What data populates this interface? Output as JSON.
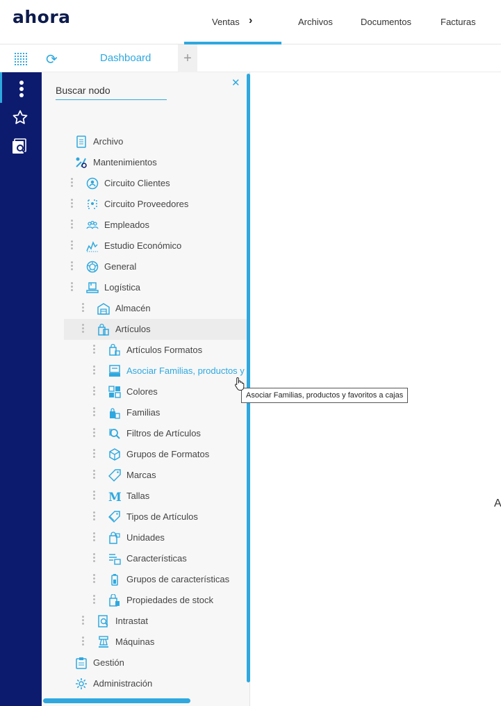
{
  "app": {
    "logo_text": "ahora"
  },
  "topnav": {
    "items": [
      {
        "label": "Ventas",
        "active": true
      },
      {
        "label": "Archivos"
      },
      {
        "label": "Documentos"
      },
      {
        "label": "Facturas"
      }
    ]
  },
  "tabs": {
    "dashboard": "Dashboard",
    "add": "+"
  },
  "search": {
    "placeholder": "Buscar nodo"
  },
  "tree": [
    {
      "label": "Archivo",
      "icon": "document-icon",
      "level": 0,
      "handle": false
    },
    {
      "label": "Mantenimientos",
      "icon": "tools-icon",
      "level": 0,
      "handle": false
    },
    {
      "label": "Circuito Clientes",
      "icon": "user-circle-icon",
      "level": 1
    },
    {
      "label": "Circuito Proveedores",
      "icon": "supplier-flow-icon",
      "level": 1
    },
    {
      "label": "Empleados",
      "icon": "employees-icon",
      "level": 1
    },
    {
      "label": "Estudio Económico",
      "icon": "chart-icon",
      "level": 1
    },
    {
      "label": "General",
      "icon": "aperture-icon",
      "level": 1
    },
    {
      "label": "Logística",
      "icon": "warehouse-box-icon",
      "level": 1
    },
    {
      "label": "Almacén",
      "icon": "warehouse-icon",
      "level": 2
    },
    {
      "label": "Artículos",
      "icon": "shopping-bags-icon",
      "level": 2,
      "selected": true
    },
    {
      "label": "Artículos Formatos",
      "icon": "bag-format-icon",
      "level": 3
    },
    {
      "label": "Asociar Familias, productos y",
      "icon": "register-icon",
      "level": 3,
      "highlight": true
    },
    {
      "label": "Colores",
      "icon": "colors-icon",
      "level": 3
    },
    {
      "label": "Familias",
      "icon": "family-bags-icon",
      "level": 3
    },
    {
      "label": "Filtros de Artículos",
      "icon": "search-filter-icon",
      "level": 3
    },
    {
      "label": "Grupos de Formatos",
      "icon": "cube-icon",
      "level": 3
    },
    {
      "label": "Marcas",
      "icon": "tag-icon",
      "level": 3
    },
    {
      "label": "Tallas",
      "icon": "size-m-icon",
      "level": 3
    },
    {
      "label": "Tipos de Artículos",
      "icon": "tags-icon",
      "level": 3
    },
    {
      "label": "Unidades",
      "icon": "units-icon",
      "level": 3
    },
    {
      "label": "Características",
      "icon": "features-list-icon",
      "level": 3
    },
    {
      "label": "Grupos de características",
      "icon": "battery-icon",
      "level": 3
    },
    {
      "label": "Propiedades de stock",
      "icon": "stock-icon",
      "level": 3
    },
    {
      "label": "Intrastat",
      "icon": "doc-search-icon",
      "level": 2
    },
    {
      "label": "Máquinas",
      "icon": "machine-icon",
      "level": 2
    },
    {
      "label": "Gestión",
      "icon": "clipboard-icon",
      "level": 0,
      "handle": false
    },
    {
      "label": "Administración",
      "icon": "admin-gear-icon",
      "level": 0,
      "handle": false
    }
  ],
  "tooltip": {
    "text": "Asociar Familias, productos y favoritos a cajas"
  },
  "main": {
    "partial_text": "A"
  },
  "colors": {
    "accent": "#2ea8df",
    "rail": "#0d1b6e",
    "logo": "#0d1b4c"
  }
}
